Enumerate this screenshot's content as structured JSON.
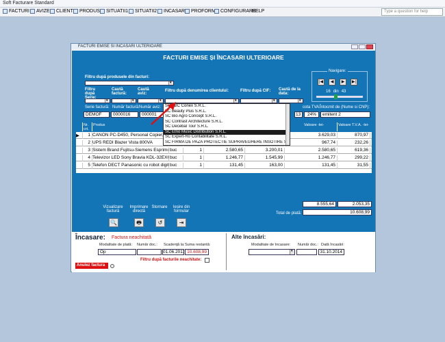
{
  "app": {
    "title": "Soft Facturare Standard"
  },
  "menu": [
    {
      "label": "FACTURI"
    },
    {
      "label": "AVIZE"
    },
    {
      "label": "CLIENTI"
    },
    {
      "label": "PRODUSE"
    },
    {
      "label": "SITUATII1"
    },
    {
      "label": "SITUATII2"
    },
    {
      "label": "INCASARI"
    },
    {
      "label": "PROFORME"
    },
    {
      "label": "CONFIGURARE"
    },
    {
      "label": "HELP"
    }
  ],
  "help_placeholder": "Type a question for help",
  "window": {
    "title": "FACTURI EMISE SI INCASARI ULTERIOARE"
  },
  "main": {
    "title": "FACTURI EMISE ȘI ÎNCASARI ULTERIOARE",
    "filter_products": "Filtru după produsele din facturi:",
    "filter_serie": "Filtru după Serie:",
    "search_invoice": "Caută factură:",
    "search_aviz": "Caută aviz:",
    "filter_client": "Filtru după denumirea clientului:",
    "filter_cif": "Filtru după CIF:",
    "search_date": "Caută de la data:",
    "nav_label": "Navigare:",
    "nav_first": "|◀",
    "nav_prev": "◀",
    "nav_next": "▶",
    "nav_last": "▶|",
    "nav_pos": "16",
    "nav_of": "din",
    "nav_total": "43"
  },
  "header": {
    "serie_label": "Serie factură:",
    "nr_label": "Număr factură:",
    "aviz_label": "Număr aviz:",
    "cota_label": "cota TVA:",
    "intocmit_label": "Întocmit de (Nume si CNP):",
    "serie": "DEMOF",
    "nr": "0000016",
    "aviz": "000001",
    "cota_prefix": "13",
    "cota": "24%",
    "intocmit": "emitent 2"
  },
  "client_dropdown": [
    "SC ABC Conex S.R.L.",
    "SC Beauty Plus S.R.L.",
    "SC Bio Agro Concept S.R.L.",
    "SC Contrast Architecture S.R.L.",
    "SC Decebal Tour S.R.L.",
    "SC Etno Music Distribution S.R.L.",
    "SC Expert-Ro Contabilitate S.R.L.",
    "SC FIRMA DE PAZA PROTECTIE SUPRAVEGHERE INSOTIRE SI INT"
  ],
  "grid": {
    "headers": {
      "nr": "Nr. crt.",
      "produs": "Produs",
      "valoare": "Valoare -lei-",
      "tva": "Valoare T.V.A. -lei-"
    },
    "rows": [
      {
        "nr": "1",
        "produs": "CANON PC-D450, Personal Copier, 22",
        "um": "",
        "cant": "",
        "pret": "",
        "pret2": "",
        "valoare": "3.629,03",
        "tva": "870,97"
      },
      {
        "nr": "2",
        "produs": "UPS REDI Blazer Vista 800VA",
        "um": "",
        "cant": "",
        "pret": "",
        "pret2": "",
        "valoare": "967,74",
        "tva": "232,26"
      },
      {
        "nr": "3",
        "produs": "Sistem Brand Fujitsu-Siemens Esprimo P2560",
        "um": "buc",
        "cant": "1",
        "pret": "2.580,65",
        "pret2": "3.200,01",
        "valoare": "2.580,65",
        "tva": "619,36"
      },
      {
        "nr": "4",
        "produs": "Televizor LED Sony Bravia KDL-32EX600, 32\"",
        "um": "buc",
        "cant": "1",
        "pret": "1.246,77",
        "pret2": "1.545,99",
        "valoare": "1.246,77",
        "tva": "299,22"
      },
      {
        "nr": "5",
        "produs": "Telefon DECT Panasonic cu robot digital",
        "um": "buc",
        "cant": "1",
        "pret": "131,45",
        "pret2": "163,00",
        "valoare": "131,45",
        "tva": "31,55"
      }
    ]
  },
  "totals": {
    "valoare": "8.555,64",
    "tva": "2.053,35",
    "total_label": "Total de plată:",
    "total": "10.608,99"
  },
  "actions": {
    "viz": "Vizualizare factură",
    "print": "Imprimare directă",
    "storno": "Stornare",
    "iesire": "Ieșire din formular"
  },
  "incasare": {
    "title": "Încasare:",
    "status": "Factura neachitată",
    "mod_label": "Modalitate de plată:",
    "nrdoc_label": "Număr doc.:",
    "scad_label": "Scadență la:",
    "suma_label": "Suma restantă:",
    "mod": "Op",
    "nrdoc": "",
    "scad": "01.06.2013",
    "suma": "10.608,99",
    "filter_unpaid": "Filtru după facturile neachitate:",
    "cancel": "Anulez factura"
  },
  "alte": {
    "title": "Alte încasări:",
    "mod_label": "Modalitate de încasare:",
    "nrdoc_label": "Număr doc.:",
    "data_label": "Dată încasări:",
    "data": "31.10.2014"
  }
}
